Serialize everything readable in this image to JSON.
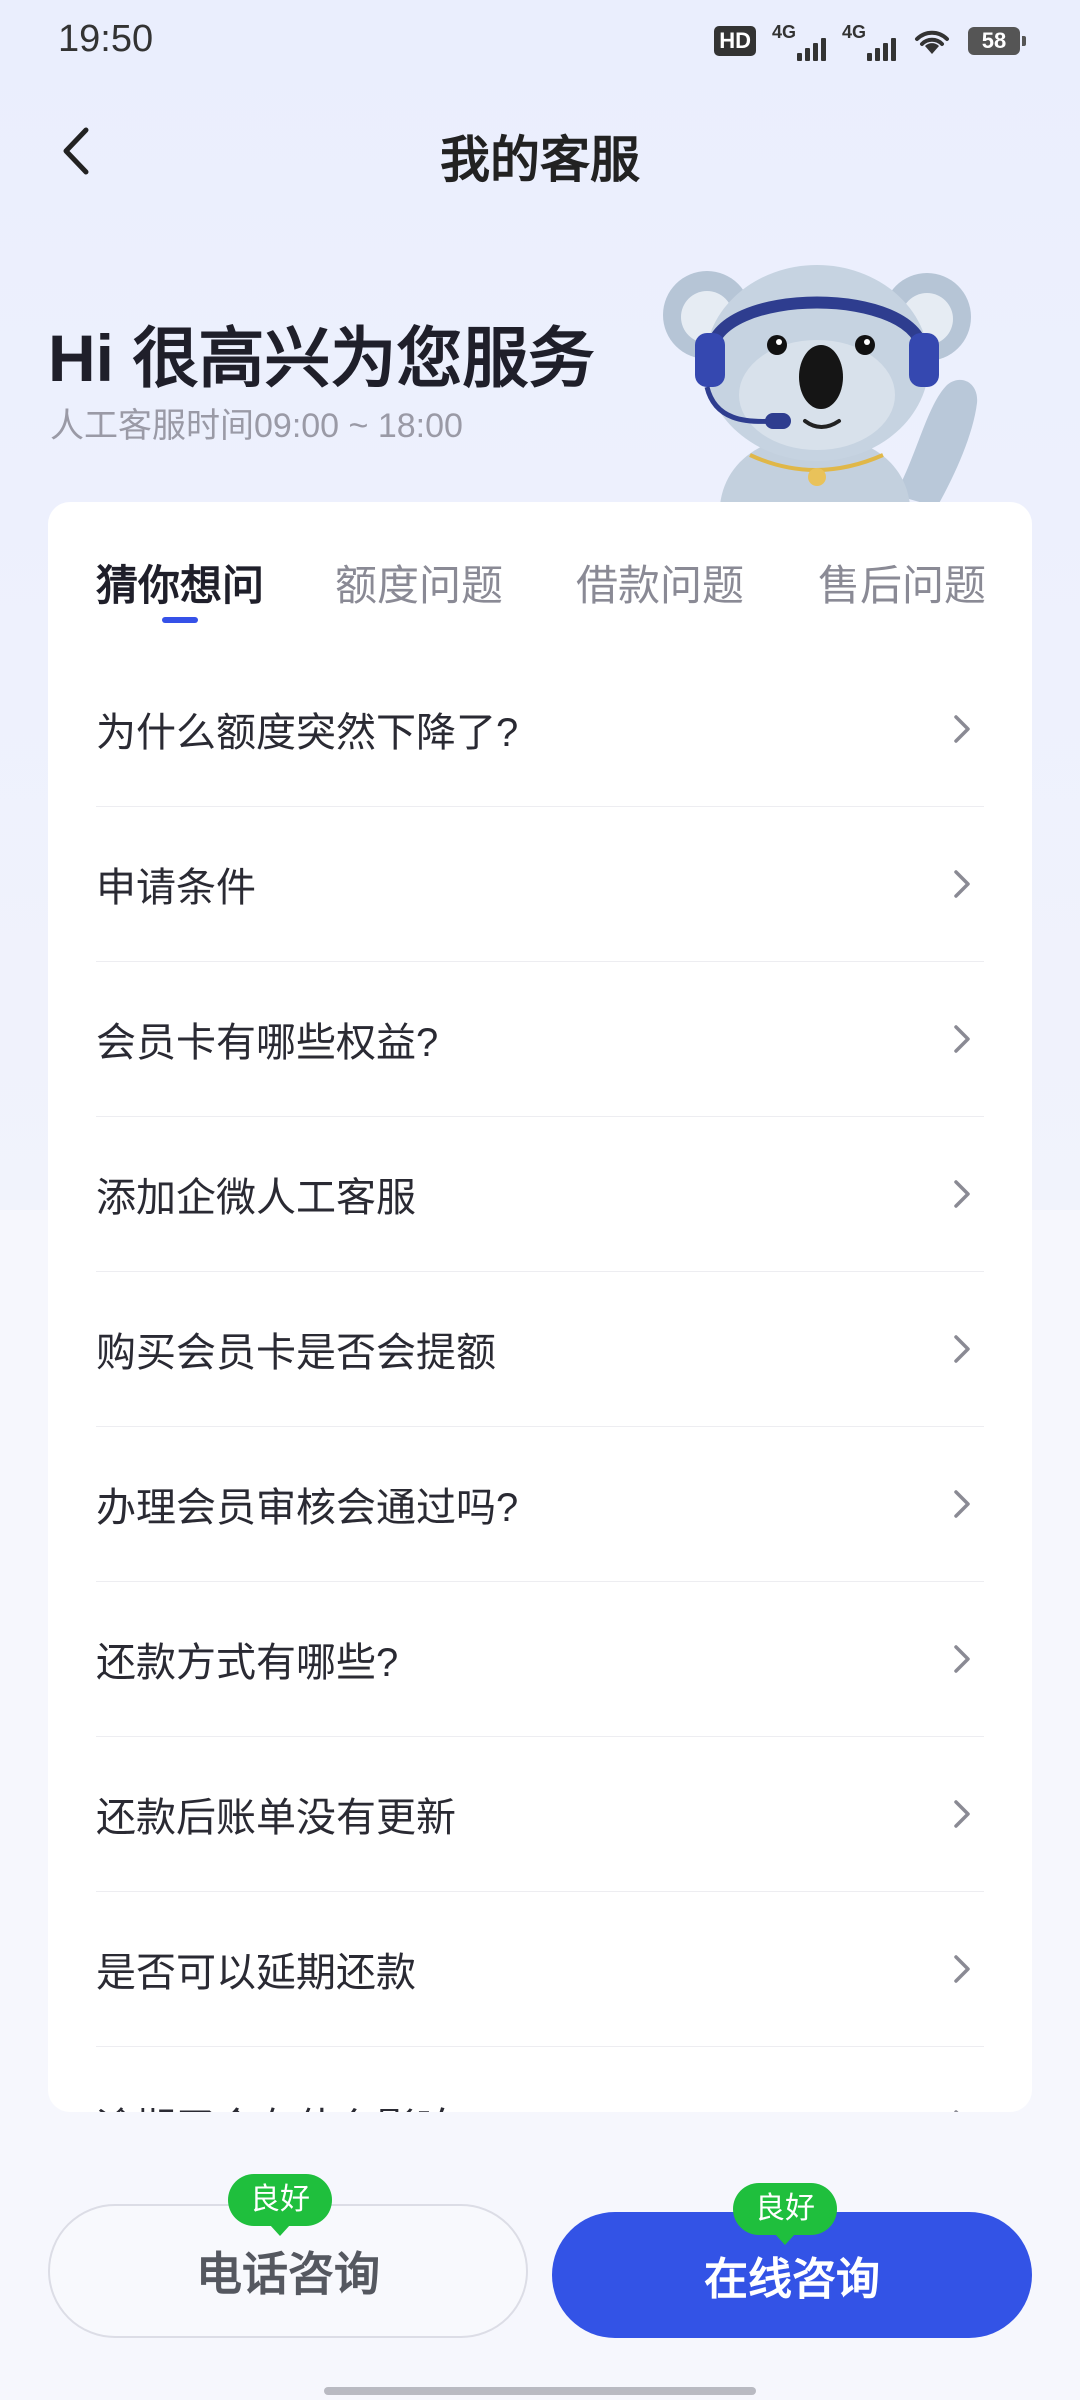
{
  "status_bar": {
    "time": "19:50",
    "hd_label": "HD",
    "network_1": "4G",
    "network_2": "4G",
    "battery": "58"
  },
  "header": {
    "title": "我的客服"
  },
  "hero": {
    "greeting": "Hi 很高兴为您服务",
    "service_hours": "人工客服时间09:00 ~ 18:00"
  },
  "tabs": [
    {
      "label": "猜你想问",
      "active": true
    },
    {
      "label": "额度问题",
      "active": false
    },
    {
      "label": "借款问题",
      "active": false
    },
    {
      "label": "售后问题",
      "active": false
    }
  ],
  "faq": [
    "为什么额度突然下降了?",
    "申请条件",
    "会员卡有哪些权益?",
    "添加企微人工客服",
    "购买会员卡是否会提额",
    "办理会员审核会通过吗?",
    "还款方式有哪些?",
    "还款后账单没有更新",
    "是否可以延期还款",
    "逾期了会有什么影响"
  ],
  "actions": {
    "phone": {
      "label": "电话咨询",
      "badge": "良好"
    },
    "online": {
      "label": "在线咨询",
      "badge": "良好"
    }
  },
  "colors": {
    "accent": "#3353e6",
    "badge_green": "#1fbf3d"
  }
}
